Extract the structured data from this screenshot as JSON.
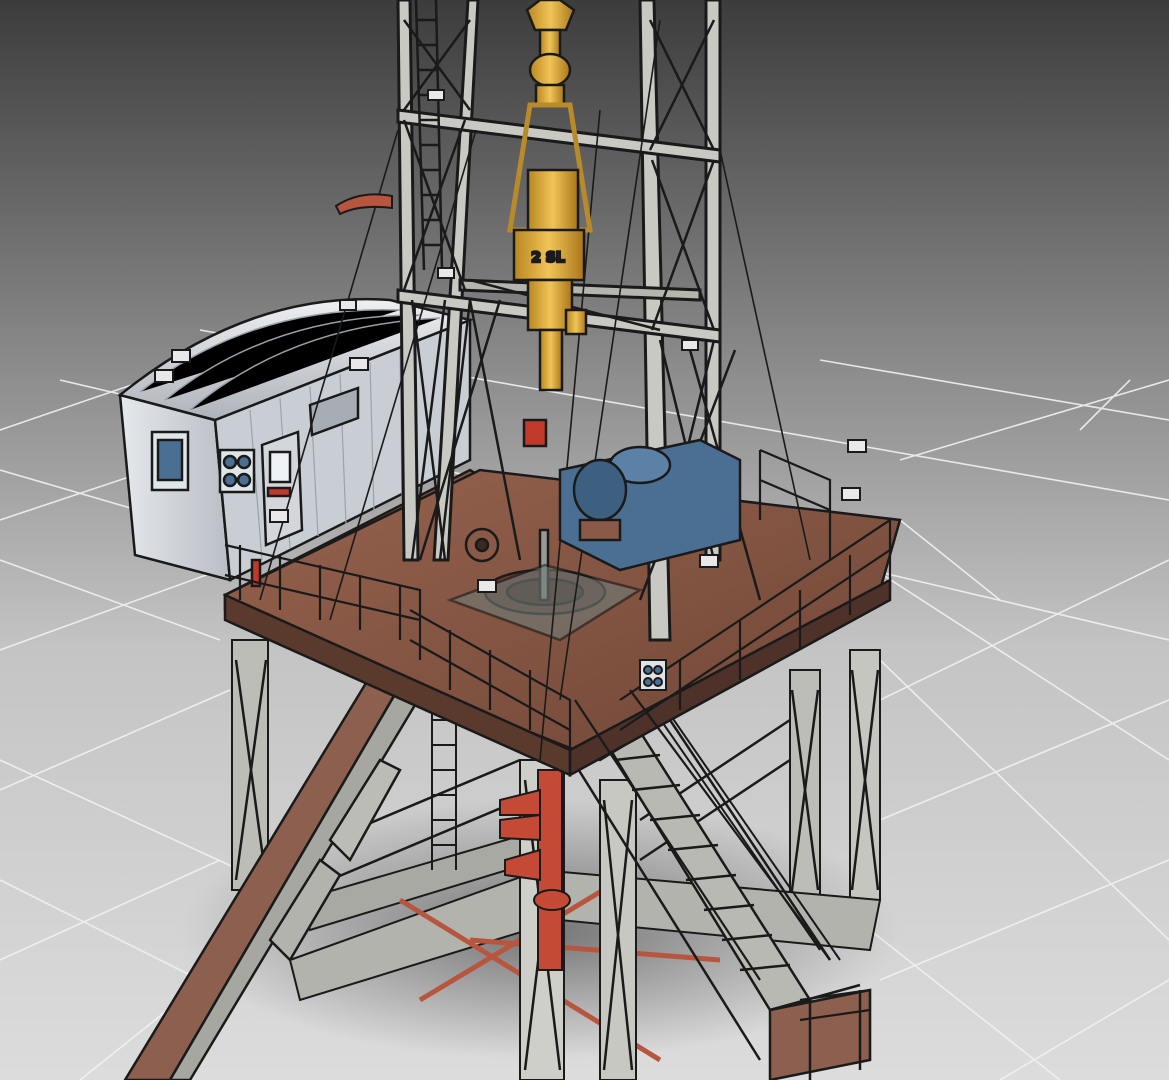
{
  "scene": {
    "block_label": "2 SL",
    "colors": {
      "background_top": "#3a3a3a",
      "background_bottom": "#d8d8d8",
      "grid_line": "#f4f4f4",
      "steel": "#c9c9c4",
      "steel_dark": "#8a8a86",
      "rust_deck": "#8a5a48",
      "rust_dark": "#6e4536",
      "hook_yellow": "#d9a53a",
      "motor_blue": "#4a6f92",
      "cabin_white": "#d7dbe0",
      "red_accent": "#c0392b",
      "outline": "#1a1a1a"
    }
  }
}
